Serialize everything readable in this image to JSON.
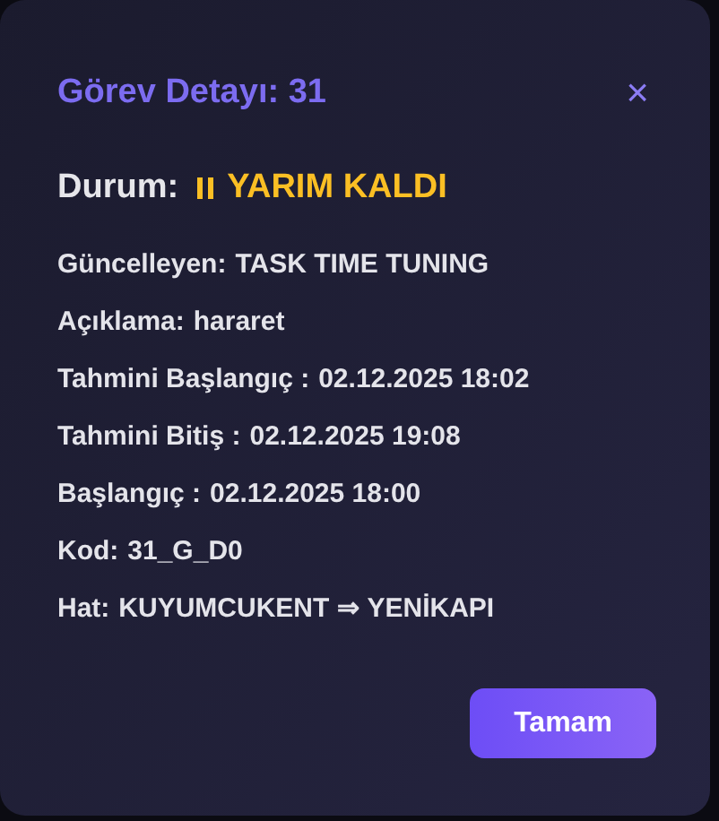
{
  "dialog": {
    "title": "Görev Detayı: 31",
    "close": "×",
    "status": {
      "label": "Durum:",
      "value": "YARIM KALDI"
    },
    "fields": [
      {
        "label": "Güncelleyen:",
        "value": "TASK TIME TUNING"
      },
      {
        "label": "Açıklama:",
        "value": "hararet"
      },
      {
        "label": "Tahmini Başlangıç :",
        "value": "02.12.2025 18:02"
      },
      {
        "label": "Tahmini Bitiş :",
        "value": "02.12.2025 19:08"
      },
      {
        "label": "Başlangıç :",
        "value": "02.12.2025 18:00"
      },
      {
        "label": "Kod:",
        "value": "31_G_D0"
      },
      {
        "label": "Hat:",
        "value": "KUYUMCUKENT ⇒ YENİKAPI"
      }
    ],
    "buttons": [
      "Tamam"
    ]
  }
}
